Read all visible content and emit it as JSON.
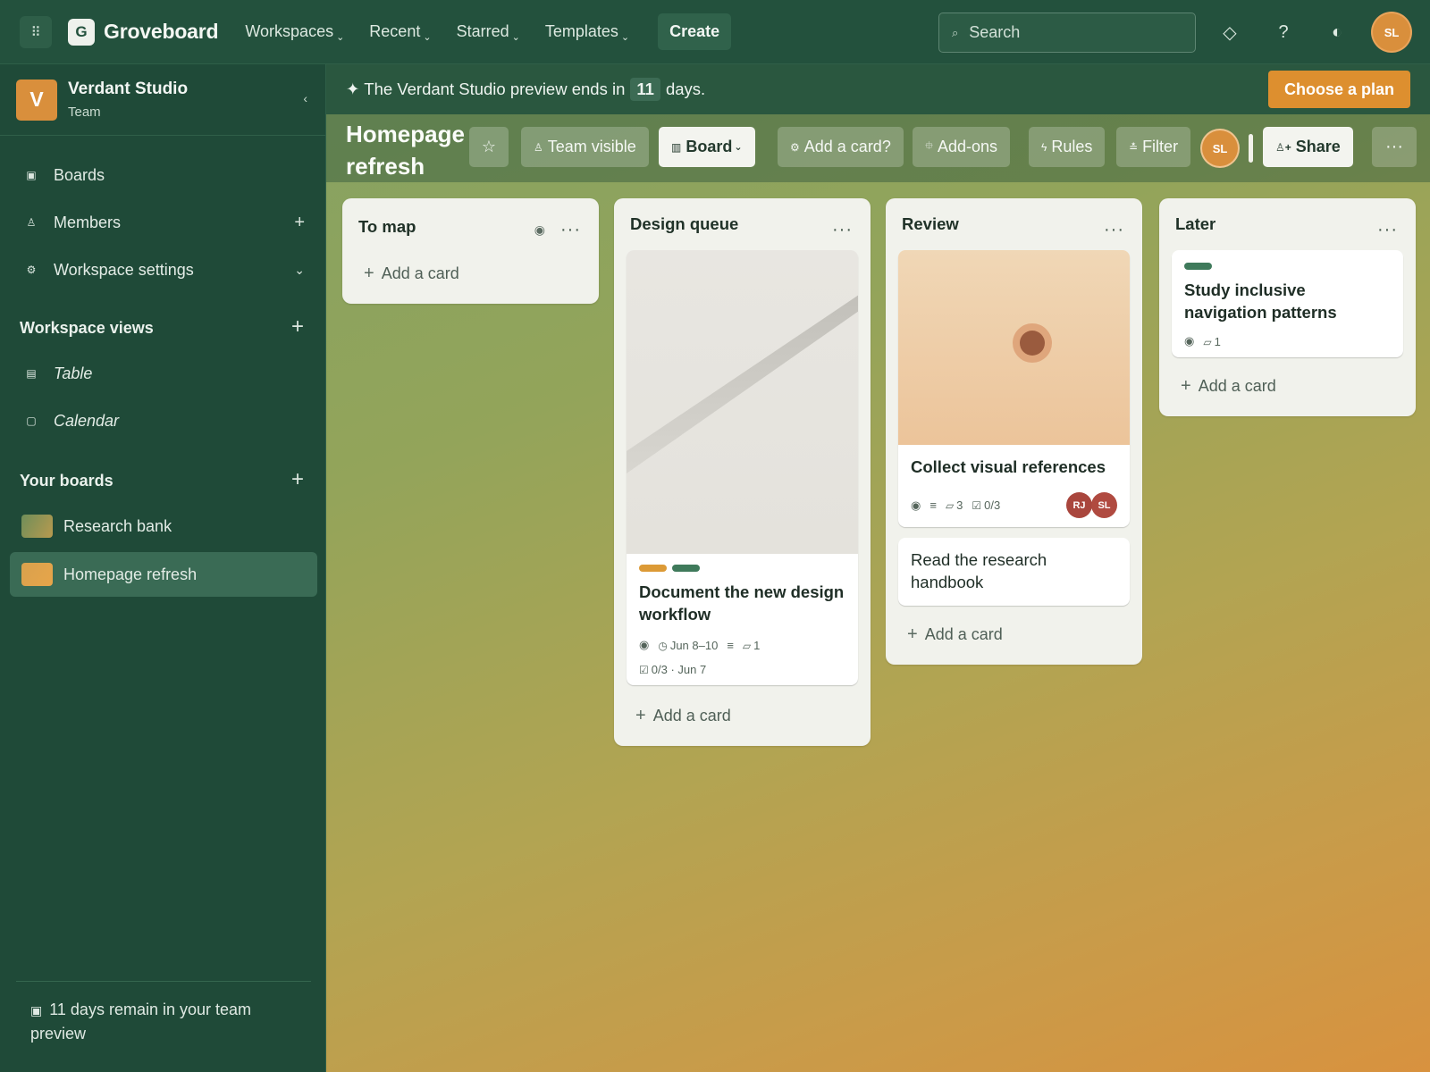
{
  "topbar": {
    "apps_icon": "grid-icon",
    "logo_letter": "G",
    "app_name": "Groveboard",
    "nav": [
      "Workspaces",
      "Recent",
      "Starred",
      "Templates"
    ],
    "create_label": "Create",
    "search_placeholder": "Search",
    "user_initials": "SL"
  },
  "sidebar": {
    "workspace_letter": "V",
    "workspace_name": "Verdant Studio",
    "workspace_type": "Team",
    "items": [
      {
        "label": "Boards",
        "icon": "board-icon"
      },
      {
        "label": "Members",
        "icon": "person-icon"
      },
      {
        "label": "Workspace settings",
        "icon": "gear-icon"
      }
    ],
    "views_heading": "Workspace views",
    "views": [
      {
        "label": "Table",
        "icon": "table-icon"
      },
      {
        "label": "Calendar",
        "icon": "calendar-icon"
      }
    ],
    "boards_heading": "Your boards",
    "boards": [
      {
        "label": "Research bank",
        "active": false
      },
      {
        "label": "Homepage refresh",
        "active": true
      }
    ],
    "footer_text": "11 days remain in your team preview"
  },
  "banner": {
    "prefix": "✦ The Verdant Studio preview ends in",
    "days": "11",
    "suffix": "days.",
    "cta": "Choose a plan"
  },
  "board": {
    "title": "Homepage refresh",
    "visibility": "Team visible",
    "view": "Board",
    "add_card_prompt": "Add a card?",
    "addons": "Add-ons",
    "rules": "Rules",
    "filter": "Filter",
    "member_initials": "SL",
    "share": "Share"
  },
  "add_card_label": "Add a card",
  "lists": [
    {
      "title": "To map",
      "cards": []
    },
    {
      "title": "Design queue",
      "cards": [
        {
          "labels": [
            "#dc9a36",
            "#3f7a5b"
          ],
          "title": "Document the new design workflow",
          "dates": "Jun 8–10",
          "attachments": "1",
          "checklist": "0/3 · Jun 7"
        }
      ]
    },
    {
      "title": "Review",
      "cards": [
        {
          "title": "Collect visual references",
          "attachments": "3",
          "checklist": "0/3",
          "members": [
            {
              "initials": "RJ",
              "color": "#a9463d"
            },
            {
              "initials": "SL",
              "color": "#b04a40"
            }
          ]
        },
        {
          "title": "Read the research handbook"
        }
      ]
    },
    {
      "title": "Later",
      "cards": [
        {
          "labels": [
            "#3f7a5b"
          ],
          "title": "Study inclusive navigation patterns",
          "attachments": "1"
        }
      ]
    }
  ],
  "colors": {
    "sidebar": "#1f4a38",
    "topbar": "#23513d",
    "accent": "#dd8f2f",
    "brand_green": "#3f7a5b"
  }
}
